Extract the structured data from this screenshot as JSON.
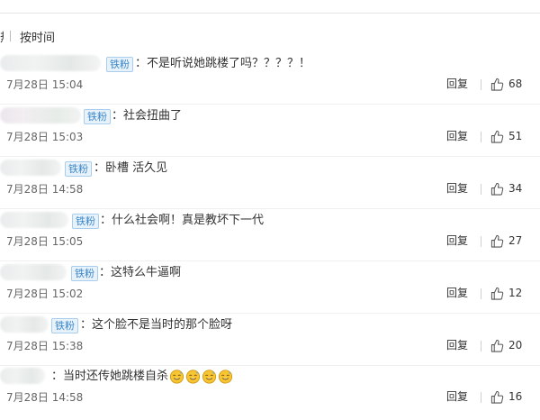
{
  "sort_bar": {
    "prev_label": "热度",
    "time_label": "按时间"
  },
  "comments": [
    {
      "fan_badge": "铁粉",
      "text": "不是听说她跳楼了吗？？？？！",
      "time": "7月28日 15:04",
      "reply_label": "回复",
      "likes": "68"
    },
    {
      "fan_badge": "铁粉",
      "text": "社会扭曲了",
      "time": "7月28日 15:03",
      "reply_label": "回复",
      "likes": "51"
    },
    {
      "fan_badge": "铁粉",
      "text": "卧槽 活久见",
      "time": "7月28日 14:58",
      "reply_label": "回复",
      "likes": "34"
    },
    {
      "fan_badge": "铁粉",
      "text": "什么社会啊！真是教坏下一代",
      "time": "7月28日 15:05",
      "reply_label": "回复",
      "likes": "27"
    },
    {
      "fan_badge": "铁粉",
      "text": "这特么牛逼啊",
      "time": "7月28日 15:02",
      "reply_label": "回复",
      "likes": "12"
    },
    {
      "fan_badge": "铁粉",
      "text": "这个脸不是当时的那个脸呀",
      "time": "7月28日 15:38",
      "reply_label": "回复",
      "likes": "20"
    },
    {
      "fan_badge": "",
      "text": "当时还传她跳楼自杀",
      "emoji": [
        "doge-sweat-emoji",
        "doge-sweat-emoji",
        "doge-sweat-emoji",
        "doge-sweat-emoji"
      ],
      "time": "7月28日 14:58",
      "reply_label": "回复",
      "likes": "16"
    }
  ],
  "icons": {
    "like": "thumbs-up-icon",
    "emoji": "doge-sweat-emoji"
  },
  "colors": {
    "badge_text": "#3a86c8",
    "badge_bg": "#e7f2fb",
    "badge_border": "#a9cdec",
    "emoji_face": "#f7c531"
  }
}
